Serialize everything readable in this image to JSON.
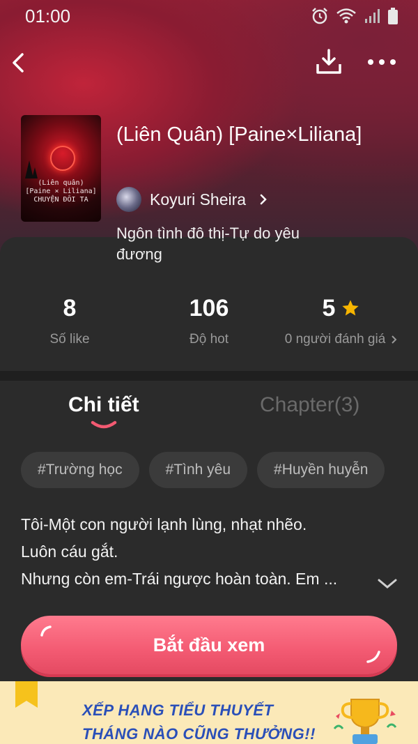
{
  "status_bar": {
    "time": "01:00",
    "icons": [
      "alarm-icon",
      "wifi-icon",
      "signal-icon",
      "battery-icon"
    ]
  },
  "nav": {
    "back_icon": "chevron-left-icon",
    "download_icon": "download-icon",
    "more_icon": "more-icon"
  },
  "story": {
    "cover_lines": [
      "(Liên quân)",
      "[Paine × Liliana]",
      "CHUYỆN ĐÔI TA"
    ],
    "title": "(Liên Quân) [Paine×Liliana]",
    "author": "Koyuri Sheira",
    "genre": "Ngôn tình đô thị-Tự do yêu đương"
  },
  "stats": [
    {
      "value": "8",
      "label": "Số like"
    },
    {
      "value": "106",
      "label": "Độ hot"
    },
    {
      "value": "5",
      "label": "0 người đánh giá"
    }
  ],
  "tabs": [
    {
      "label": "Chi tiết",
      "active": true
    },
    {
      "label": "Chapter(3)",
      "active": false
    }
  ],
  "tags": [
    "#Trường học",
    "#Tình yêu",
    "#Huyền huyễn"
  ],
  "description": [
    "Tôi-Một con người lạnh lùng, nhạt nhẽo.",
    "Luôn cáu gắt.",
    "Nhưng còn em-Trái ngược hoàn toàn. Em ..."
  ],
  "cta": {
    "label": "Bắt đầu xem"
  },
  "banner": {
    "line1": "XẾP HẠNG TIỂU THUYẾT",
    "line2": "THÁNG NÀO CŨNG THƯỞNG!!"
  },
  "colors": {
    "accent": "#f35a72",
    "star": "#f7b500",
    "banner_text": "#2a4fb8",
    "panel_bg": "#2b2b2b"
  }
}
